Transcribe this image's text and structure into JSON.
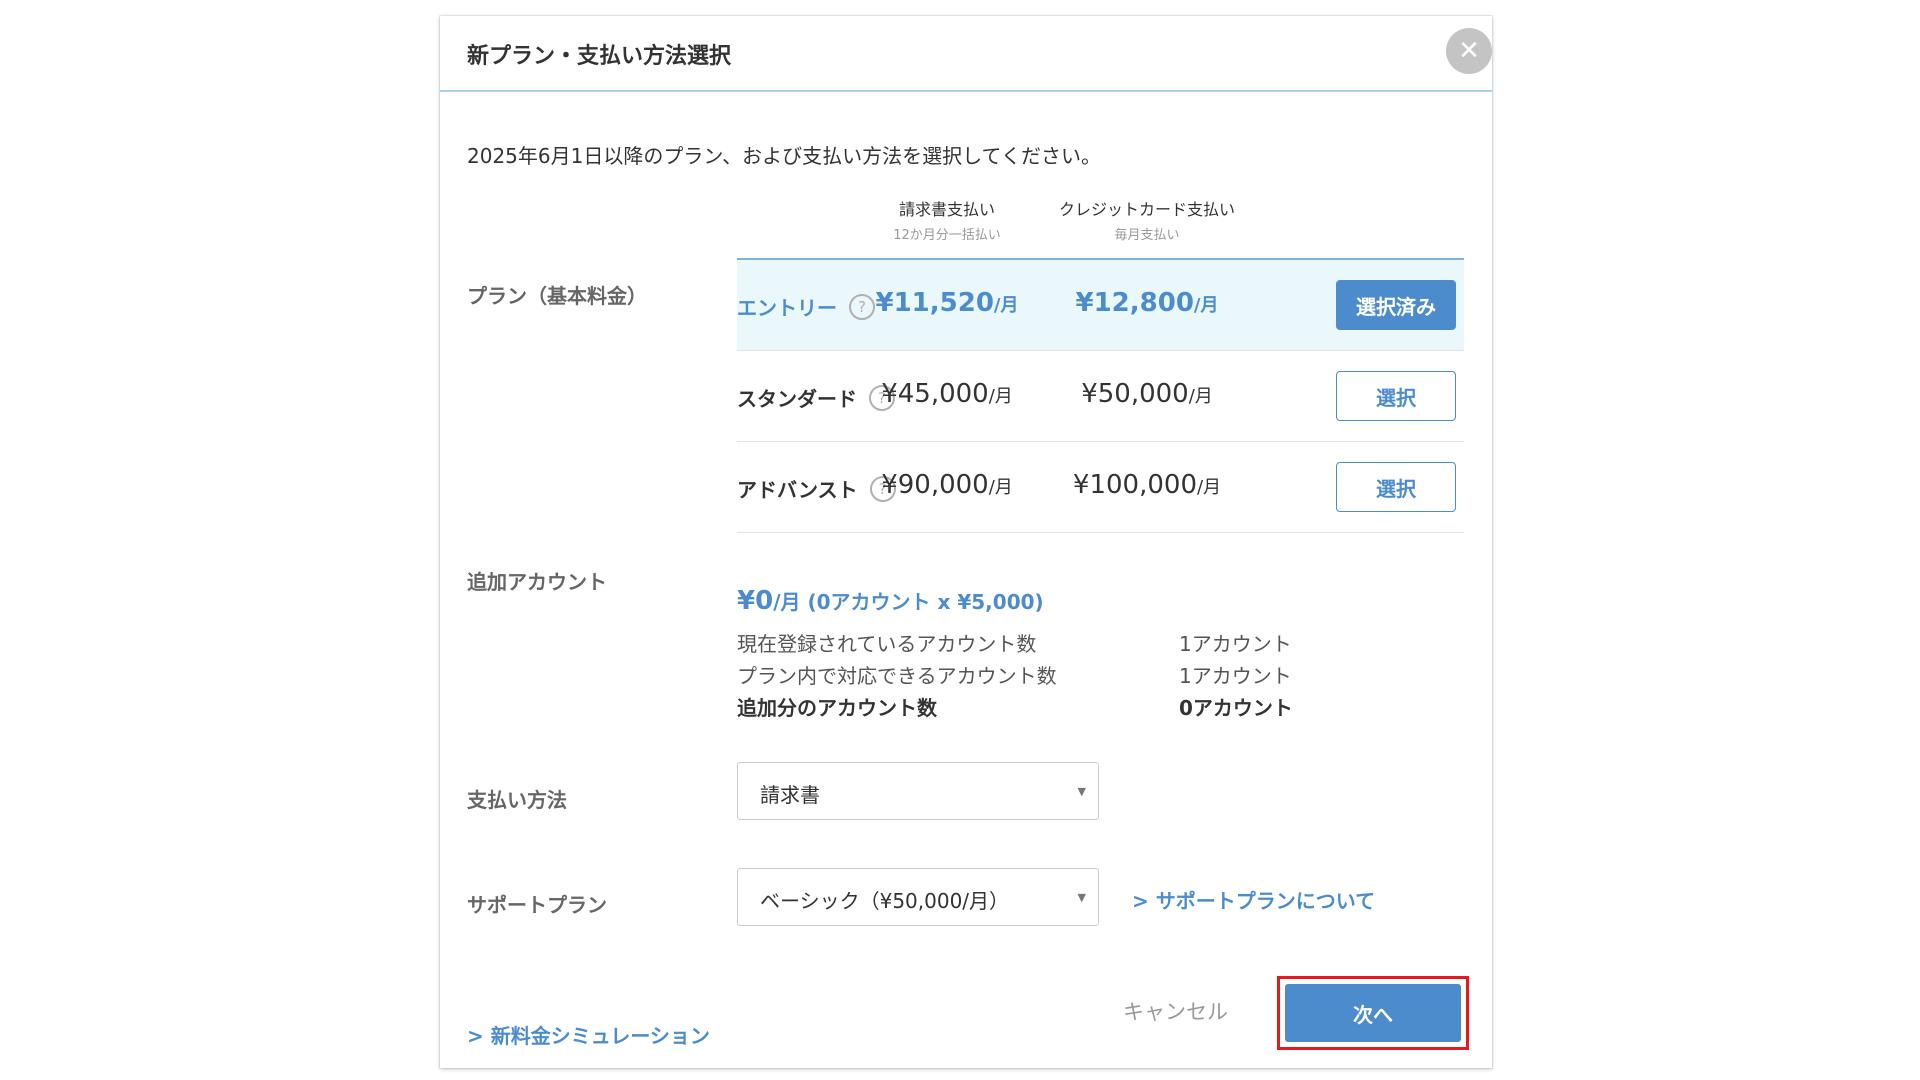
{
  "header": {
    "title": "新プラン・支払い方法選択"
  },
  "intro": "2025年6月1日以降のプラン、および支払い方法を選択してください。",
  "columns": [
    {
      "title": "請求書支払い",
      "subtitle": "12か月分一括払い"
    },
    {
      "title": "クレジットカード支払い",
      "subtitle": "毎月支払い"
    }
  ],
  "plan_section_label": "プラン（基本料金）",
  "plans": [
    {
      "name": "エントリー",
      "invoice": "¥11,520",
      "card": "¥12,800",
      "unit": "/月",
      "button": "選択済み",
      "selected": true
    },
    {
      "name": "スタンダード",
      "invoice": "¥45,000",
      "card": "¥50,000",
      "unit": "/月",
      "button": "選択",
      "selected": false
    },
    {
      "name": "アドバンスト",
      "invoice": "¥90,000",
      "card": "¥100,000",
      "unit": "/月",
      "button": "選択",
      "selected": false
    }
  ],
  "help_glyph": "?",
  "extra_account": {
    "label": "追加アカウント",
    "price": "¥0",
    "unit": "/月",
    "detail": " (0アカウント x ¥5,000)",
    "rows": [
      {
        "label": "現在登録されているアカウント数",
        "value": "1アカウント"
      },
      {
        "label": "プラン内で対応できるアカウント数",
        "value": "1アカウント"
      },
      {
        "label": "追加分のアカウント数",
        "value": "0アカウント"
      }
    ]
  },
  "payment": {
    "label": "支払い方法",
    "value": "請求書"
  },
  "support": {
    "label": "サポートプラン",
    "value": "ベーシック（¥50,000/月）",
    "link": "> サポートプランについて"
  },
  "footer": {
    "simulation_link": "> 新料金シミュレーション",
    "cancel": "キャンセル",
    "next": "次へ"
  },
  "colors": {
    "accent": "#4d8ccc",
    "selected_row": "#eaf7fb",
    "highlight": "#e8191e"
  }
}
